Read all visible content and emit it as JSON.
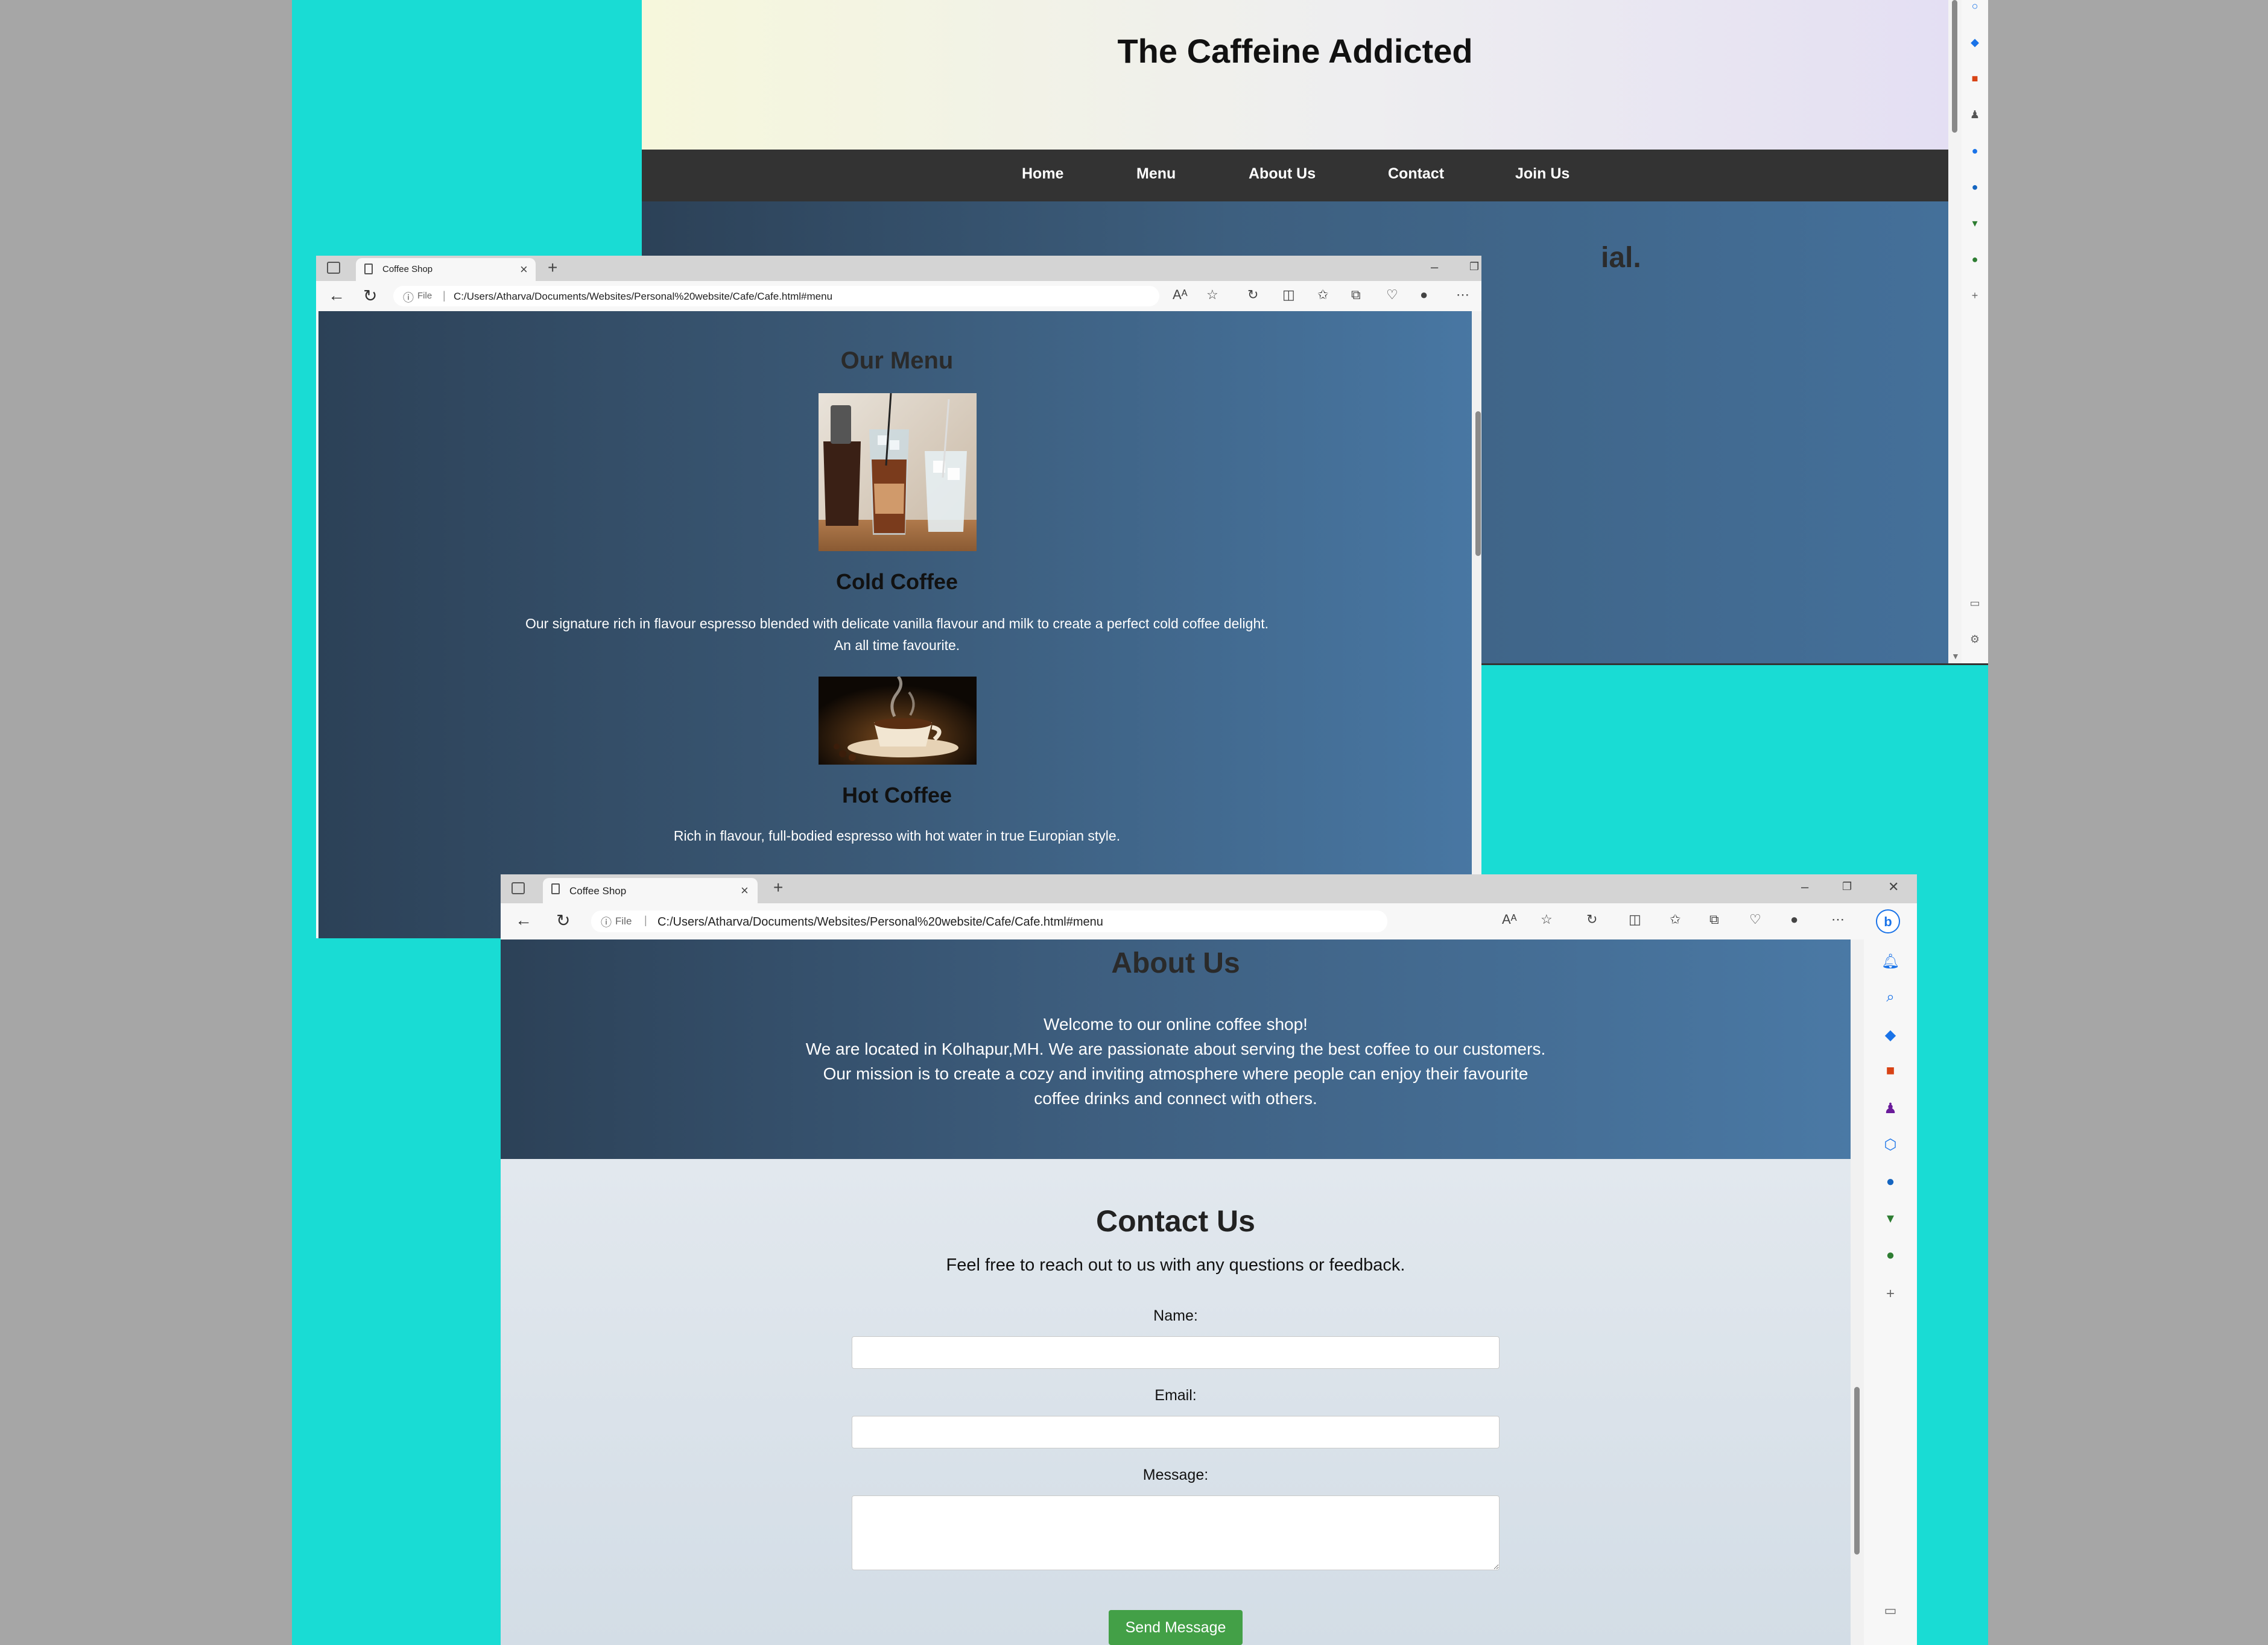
{
  "top_window": {
    "site_title": "The Caffeine Addicted",
    "nav": [
      "Home",
      "Menu",
      "About Us",
      "Contact",
      "Join Us"
    ],
    "hero_text": "ial."
  },
  "menu_window": {
    "tab_title": "Coffee Shop",
    "address": "C:/Users/Atharva/Documents/Websites/Personal%20website/Cafe/Cafe.html#menu",
    "file_label": "File",
    "section_title": "Our Menu",
    "items": [
      {
        "name": "Cold Coffee",
        "description_line1": "Our signature rich in flavour espresso blended with delicate vanilla flavour and milk to create a perfect cold coffee delight.",
        "description_line2": "An all time favourite."
      },
      {
        "name": "Hot Coffee",
        "description_line1": "Rich in flavour, full-bodied espresso with hot water in true Europian style."
      }
    ]
  },
  "about_window": {
    "tab_title": "Coffee Shop",
    "address": "C:/Users/Atharva/Documents/Websites/Personal%20website/Cafe/Cafe.html#menu",
    "file_label": "File",
    "about_title": "About Us",
    "about_lines": [
      "Welcome to our online coffee shop!",
      "We are located in Kolhapur,MH. We are passionate about serving the best coffee to our customers.",
      "Our mission is to create a cozy and inviting atmosphere where people can enjoy their favourite",
      "coffee drinks and connect with others."
    ],
    "contact": {
      "title": "Contact Us",
      "subtitle": "Feel free to reach out to us with any questions or feedback.",
      "name_label": "Name:",
      "email_label": "Email:",
      "message_label": "Message:",
      "name_value": "",
      "email_value": "",
      "message_value": "",
      "button_label": "Send Message"
    }
  },
  "colors": {
    "desktop_teal": "#19dcd4",
    "nav_bar": "#333333",
    "send_button": "#43a047",
    "copilot_blue": "#1a73e8"
  },
  "icons": {
    "toolbar": [
      "read-aloud-icon",
      "favorite-star-icon",
      "refresh-icon",
      "split-screen-icon",
      "favorites-icon",
      "collections-icon",
      "extensions-icon",
      "profile-icon",
      "more-icon",
      "copilot-icon"
    ],
    "sidebar": [
      "bell-icon",
      "search-icon",
      "tag-icon",
      "toolbox-icon",
      "games-icon",
      "office-icon",
      "outlook-icon",
      "shopping-icon",
      "tree-icon",
      "add-icon"
    ]
  }
}
